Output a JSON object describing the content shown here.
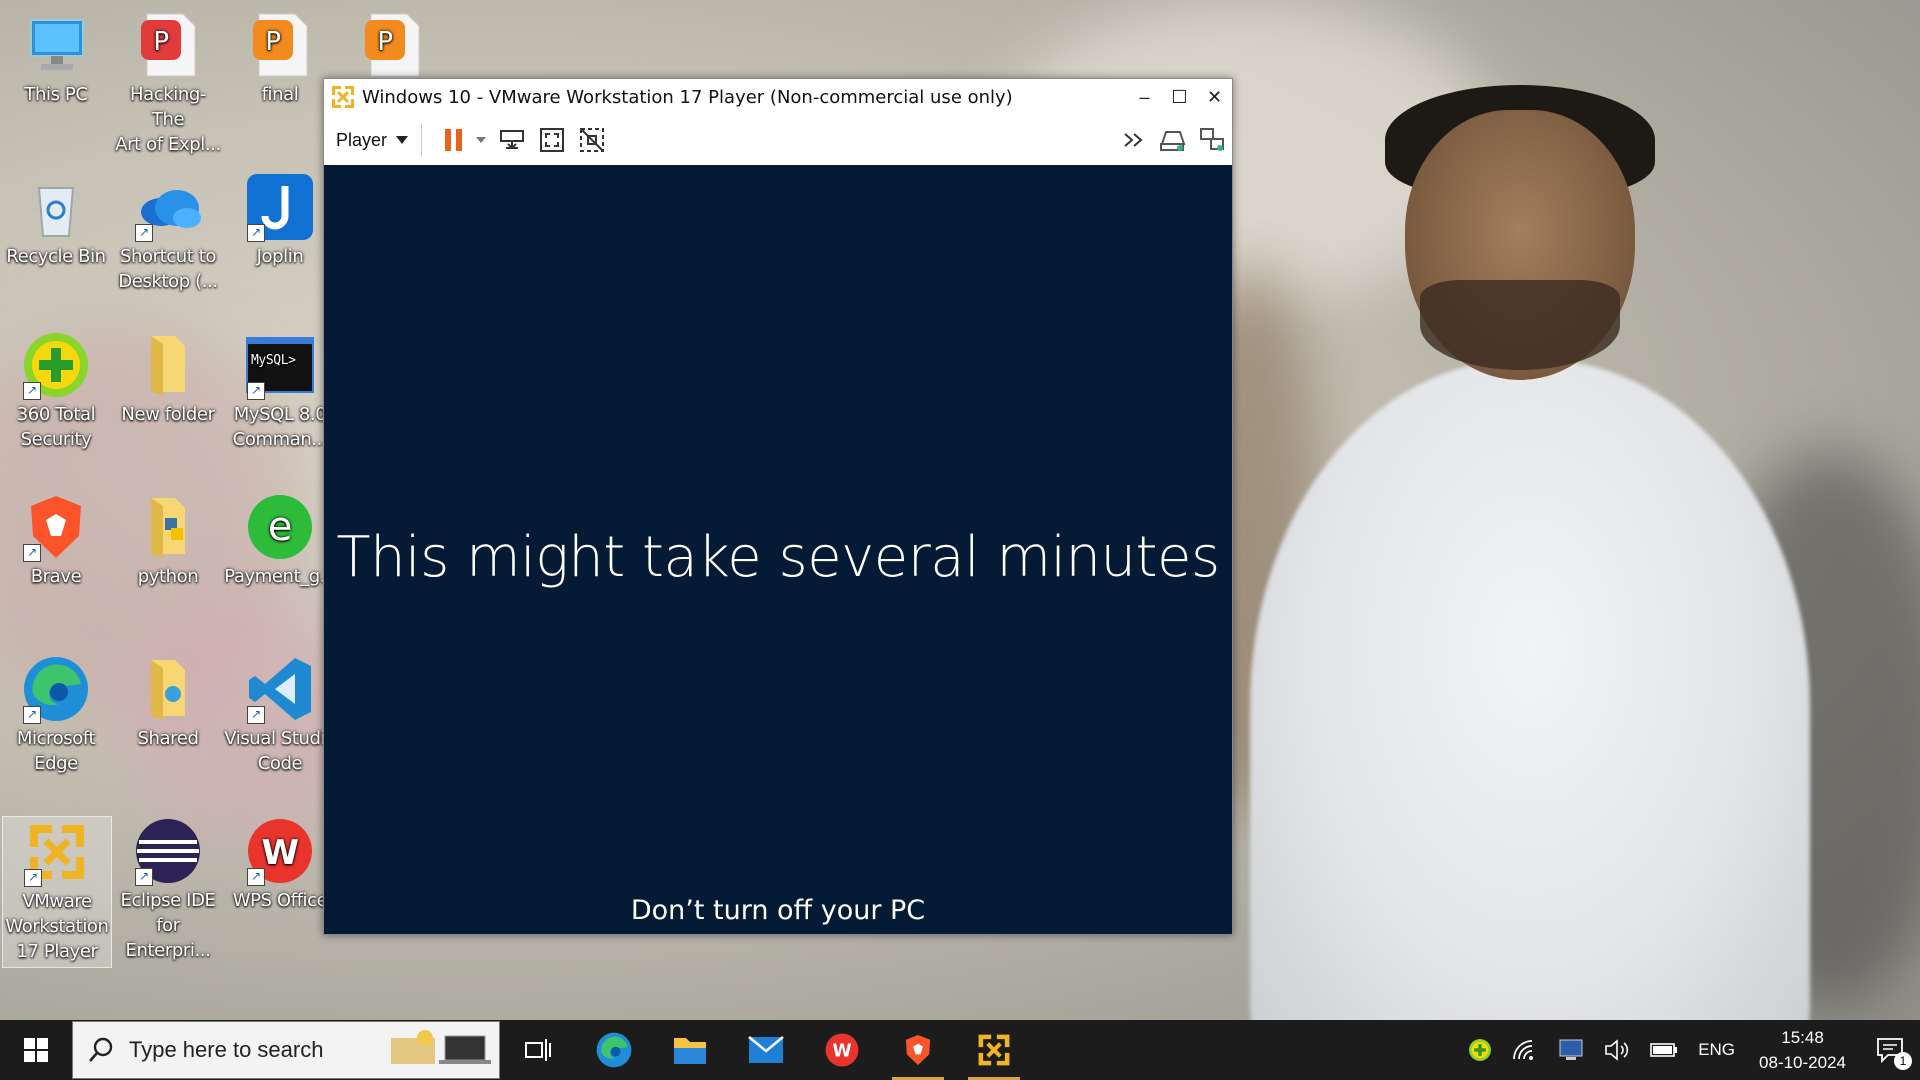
{
  "desktop": {
    "icons": [
      {
        "label": "This PC",
        "line2": ""
      },
      {
        "label": "Hacking- The",
        "line2": "Art of Expl..."
      },
      {
        "label": "final",
        "line2": ""
      },
      {
        "label": "",
        "line2": ""
      },
      {
        "label": "Recycle Bin",
        "line2": ""
      },
      {
        "label": "Shortcut to",
        "line2": "Desktop (..."
      },
      {
        "label": "Joplin",
        "line2": ""
      },
      {
        "label": "360 Total",
        "line2": "Security"
      },
      {
        "label": "New folder",
        "line2": ""
      },
      {
        "label": "MySQL 8.0",
        "line2": "Comman..."
      },
      {
        "label": "Brave",
        "line2": ""
      },
      {
        "label": "python",
        "line2": ""
      },
      {
        "label": "Payment_g...",
        "line2": ""
      },
      {
        "label": "Microsoft",
        "line2": "Edge"
      },
      {
        "label": "Shared",
        "line2": ""
      },
      {
        "label": "Visual Studio",
        "line2": "Code"
      },
      {
        "label": "VMware",
        "line2": "Workstation",
        "line3": "17 Player"
      },
      {
        "label": "Eclipse IDE",
        "line2": "for Enterpri..."
      },
      {
        "label": "WPS Office",
        "line2": ""
      }
    ],
    "mysql_icon_text": "MySQL>"
  },
  "vm_window": {
    "title": "Windows 10 - VMware Workstation 17 Player (Non-commercial use only)",
    "minimize": "–",
    "maximize": "☐",
    "close": "✕",
    "player_menu": "Player",
    "screen_main_text": "This might take several minutes",
    "screen_sub_text": "Don’t turn off your PC",
    "colors": {
      "screen_bg": "#041a35",
      "pause_orange": "#e8631c"
    }
  },
  "taskbar": {
    "search_placeholder": "Type here to search",
    "language": "ENG",
    "time": "15:48",
    "date": "08-10-2024",
    "notification_count": "1"
  }
}
